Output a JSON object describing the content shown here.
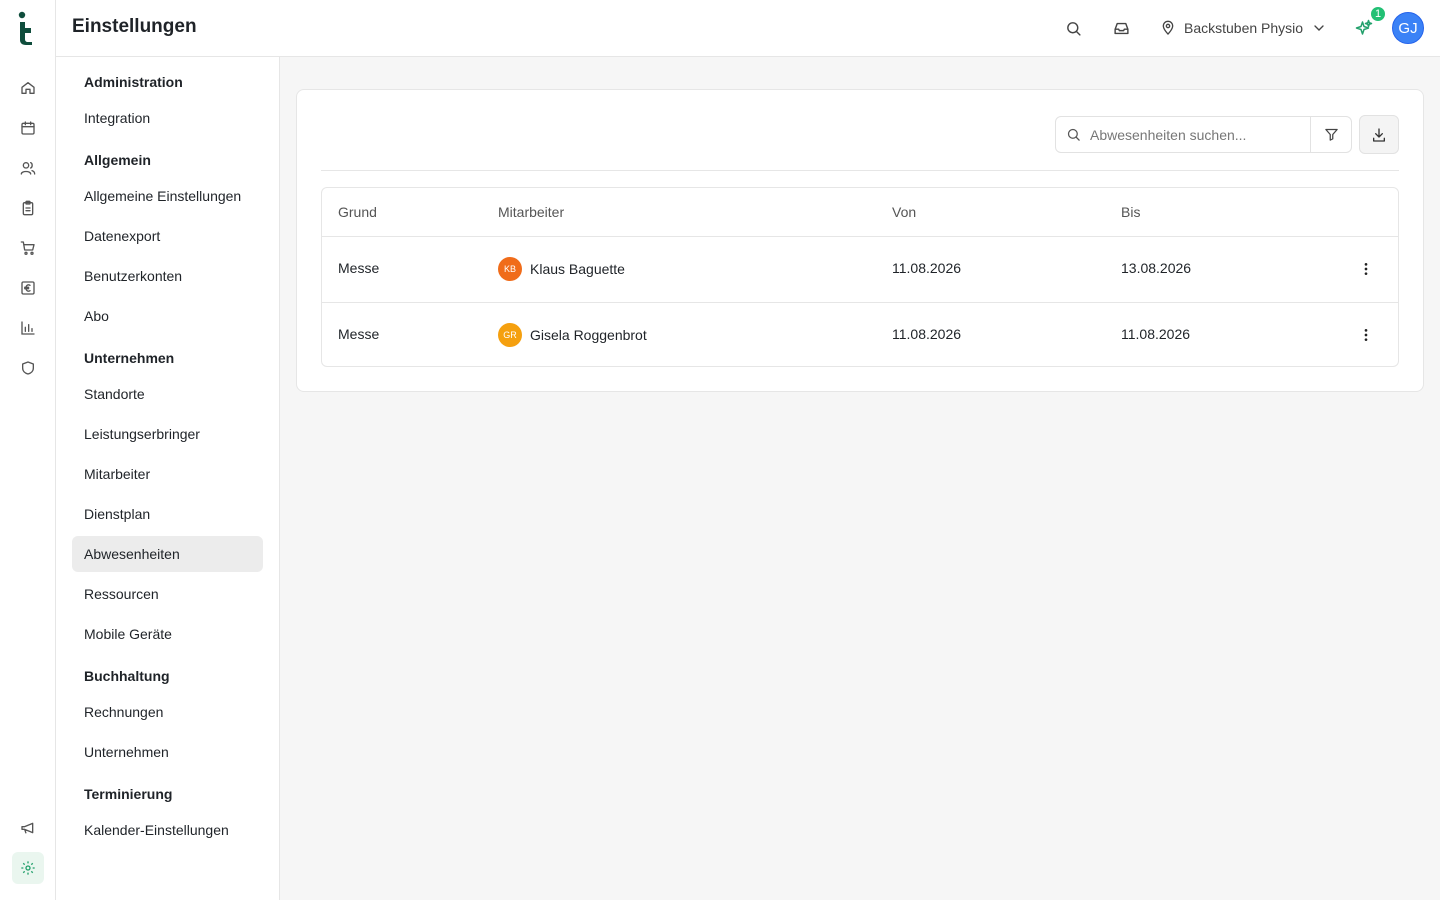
{
  "app": {
    "logo_name": "app-logo",
    "page_title": "Einstellungen"
  },
  "rail": {
    "items": [
      {
        "icon": "home-icon"
      },
      {
        "icon": "calendar-icon"
      },
      {
        "icon": "users-icon"
      },
      {
        "icon": "clipboard-icon"
      },
      {
        "icon": "cart-icon"
      },
      {
        "icon": "euro-icon"
      },
      {
        "icon": "chart-icon"
      },
      {
        "icon": "shield-icon"
      },
      {
        "icon": "megaphone-icon"
      },
      {
        "icon": "gear-icon",
        "active": true
      }
    ],
    "active_color": "#22a06b"
  },
  "topbar": {
    "location": "Backstuben Physio",
    "notification_count": "1",
    "user_initials": "GJ",
    "avatar_color": "#3b82f6"
  },
  "settings_nav": {
    "sections": [
      {
        "heading": "Administration",
        "items": [
          "Integration"
        ]
      },
      {
        "heading": "Allgemein",
        "items": [
          "Allgemeine Einstellungen",
          "Datenexport",
          "Benutzerkonten",
          "Abo"
        ]
      },
      {
        "heading": "Unternehmen",
        "items": [
          "Standorte",
          "Leistungserbringer",
          "Mitarbeiter",
          "Dienstplan",
          "Abwesenheiten",
          "Ressourcen",
          "Mobile Geräte"
        ]
      },
      {
        "heading": "Buchhaltung",
        "items": [
          "Rechnungen",
          "Unternehmen"
        ]
      },
      {
        "heading": "Terminierung",
        "items": [
          "Kalender-Einstellungen"
        ]
      }
    ],
    "active_item": "Abwesenheiten"
  },
  "search": {
    "placeholder": "Abwesenheiten suchen..."
  },
  "table": {
    "columns": [
      "Grund",
      "Mitarbeiter",
      "Von",
      "Bis"
    ],
    "rows": [
      {
        "grund": "Messe",
        "initials": "KB",
        "mitarbeiter": "Klaus Baguette",
        "avatar_color": "#f06c1a",
        "von": "11.08.2026",
        "bis": "13.08.2026"
      },
      {
        "grund": "Messe",
        "initials": "GR",
        "mitarbeiter": "Gisela Roggenbrot",
        "avatar_color": "#f5a00f",
        "von": "11.08.2026",
        "bis": "11.08.2026"
      }
    ]
  }
}
